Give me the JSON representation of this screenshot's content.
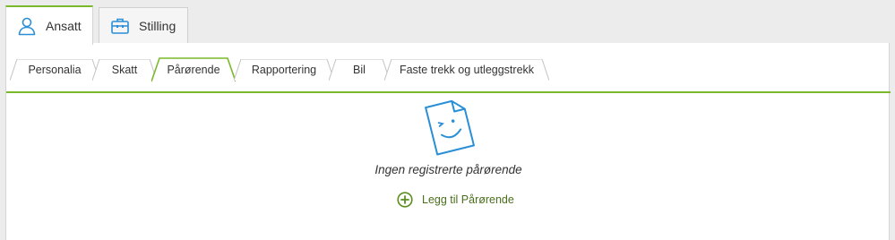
{
  "top_tabs": [
    {
      "label": "Ansatt",
      "icon": "person-icon",
      "active": true
    },
    {
      "label": "Stilling",
      "icon": "briefcase-icon",
      "active": false
    }
  ],
  "sub_tabs": [
    {
      "label": "Personalia",
      "active": false
    },
    {
      "label": "Skatt",
      "active": false
    },
    {
      "label": "Pårørende",
      "active": true
    },
    {
      "label": "Rapportering",
      "active": false
    },
    {
      "label": "Bil",
      "active": false
    },
    {
      "label": "Faste trekk og utleggstrekk",
      "active": false
    }
  ],
  "empty_state": {
    "icon": "winking-document-icon",
    "message": "Ingen registrerte pårørende",
    "add_label": "Legg til Pårørende",
    "add_icon": "plus-circle-icon"
  },
  "colors": {
    "accent_green": "#7ab929",
    "icon_blue": "#2a8fd6",
    "link_green": "#4a6f1c"
  }
}
